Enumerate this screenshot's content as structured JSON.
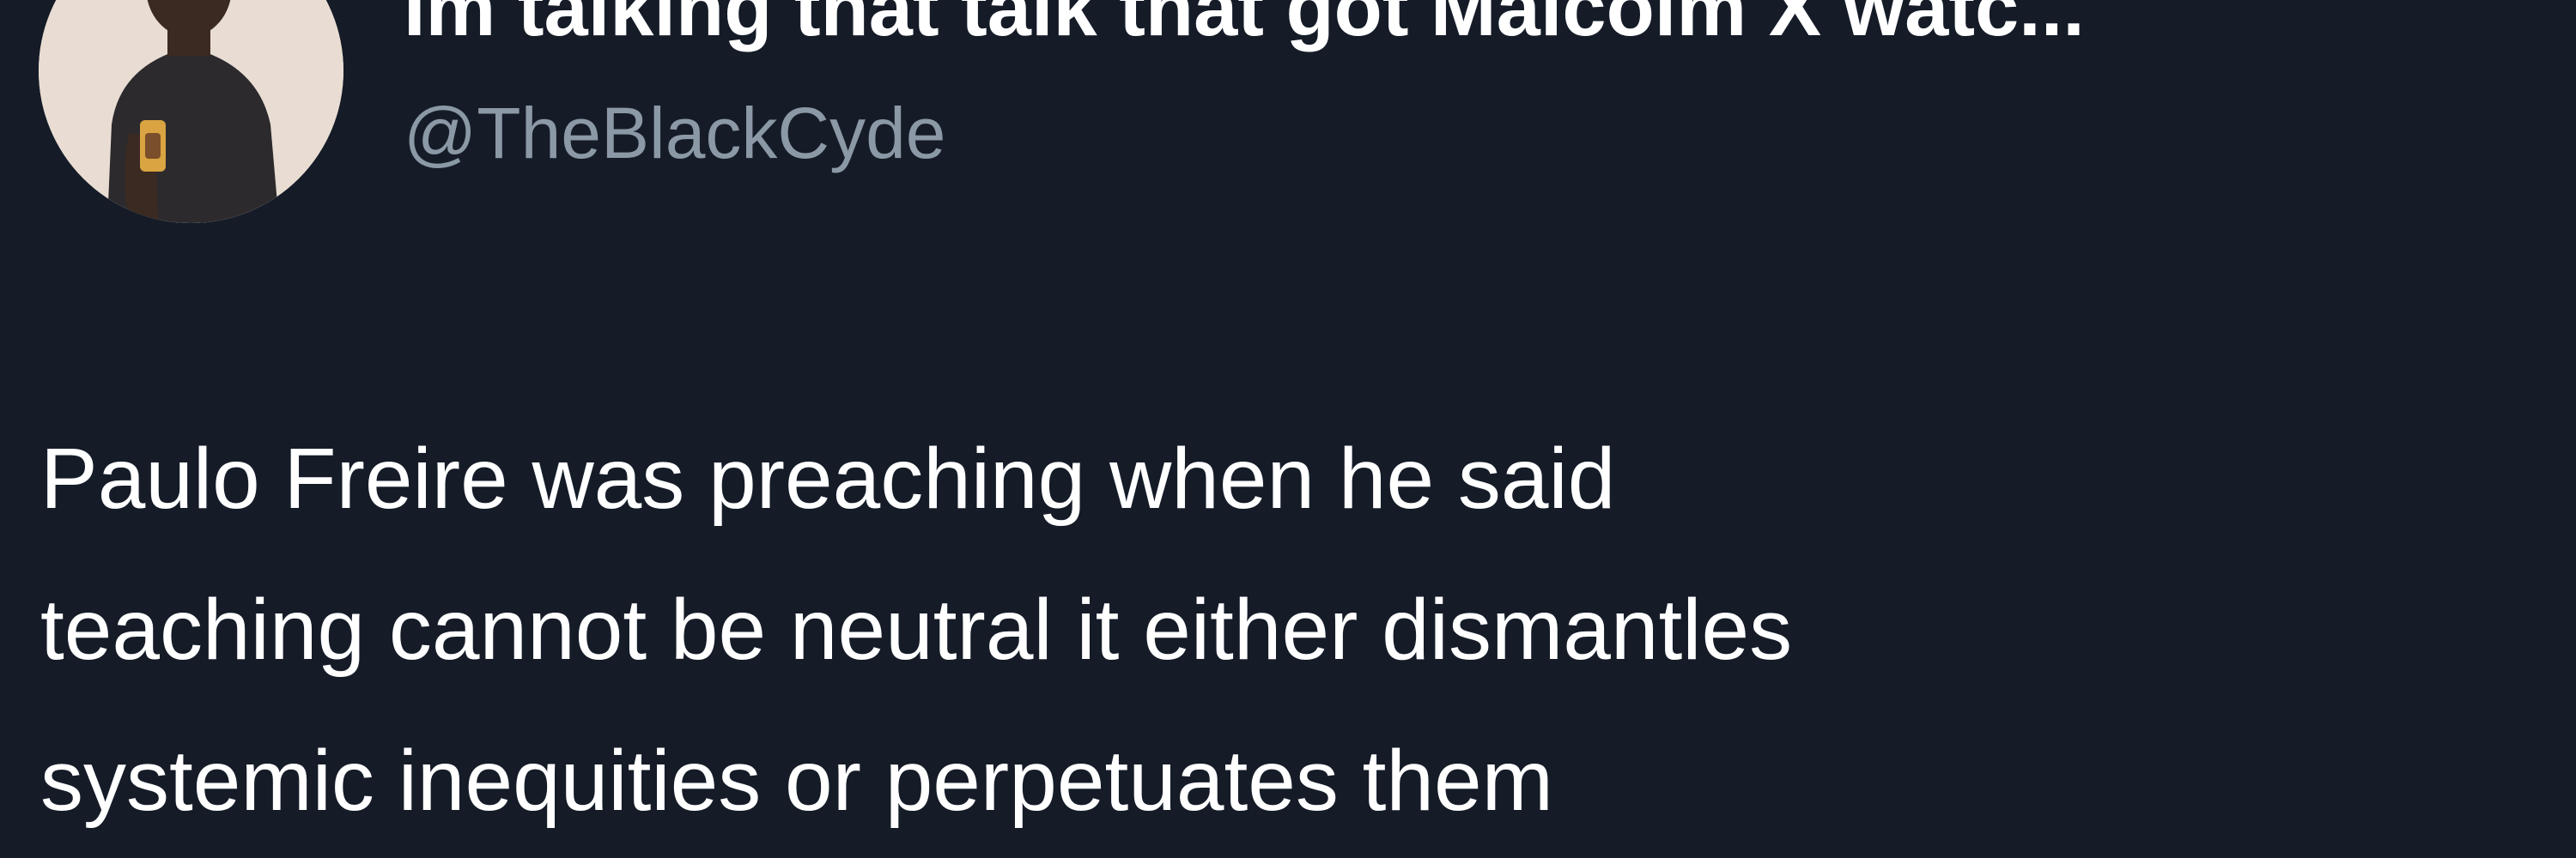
{
  "author": {
    "display_name": "Im talking that talk that got Malcolm X watc...",
    "handle": "@TheBlackCyde",
    "avatar_icon": "profile-photo"
  },
  "tweet": {
    "text": "Paulo Freire was preaching when he said\nteaching cannot be neutral it either dismantles\nsystemic inequities or perpetuates them"
  },
  "colors": {
    "background": "#151c28",
    "text_primary": "#ffffff",
    "text_secondary": "#8b98a5",
    "avatar_background": "#e9ddd3"
  }
}
